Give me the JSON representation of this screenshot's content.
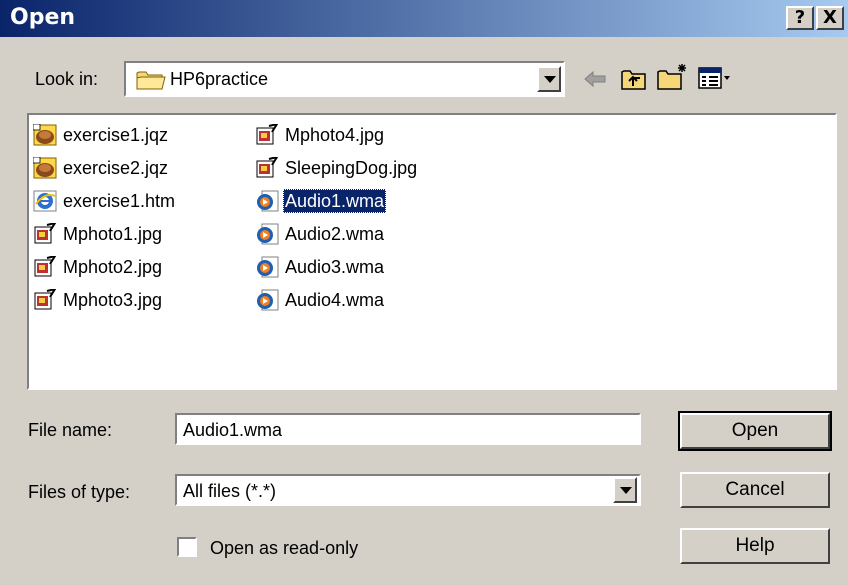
{
  "titlebar": {
    "title": "Open",
    "help_label": "?",
    "close_label": "X"
  },
  "lookin": {
    "label": "Look in:",
    "value": "HP6practice",
    "folder_icon": "folder-icon"
  },
  "toolbar": {
    "icons": [
      "back-arrow-icon",
      "up-folder-icon",
      "new-folder-icon",
      "view-menu-icon"
    ]
  },
  "files": [
    {
      "name": "exercise1.jqz",
      "icon": "jqz-icon"
    },
    {
      "name": "exercise2.jqz",
      "icon": "jqz-icon"
    },
    {
      "name": "exercise1.htm",
      "icon": "ie-icon"
    },
    {
      "name": "Mphoto1.jpg",
      "icon": "jpg-icon"
    },
    {
      "name": "Mphoto2.jpg",
      "icon": "jpg-icon"
    },
    {
      "name": "Mphoto3.jpg",
      "icon": "jpg-icon"
    },
    {
      "name": "Mphoto4.jpg",
      "icon": "jpg-icon"
    },
    {
      "name": "SleepingDog.jpg",
      "icon": "jpg-icon"
    },
    {
      "name": "Audio1.wma",
      "icon": "wma-icon",
      "selected": true
    },
    {
      "name": "Audio2.wma",
      "icon": "wma-icon"
    },
    {
      "name": "Audio3.wma",
      "icon": "wma-icon"
    },
    {
      "name": "Audio4.wma",
      "icon": "wma-icon"
    }
  ],
  "filename": {
    "label": "File name:",
    "value": "Audio1.wma"
  },
  "filetype": {
    "label": "Files of type:",
    "value": "All files (*.*)"
  },
  "readonly": {
    "label": "Open as read-only",
    "checked": false
  },
  "buttons": {
    "open": "Open",
    "cancel": "Cancel",
    "help": "Help"
  },
  "colors": {
    "title_start": "#0a246a",
    "title_end": "#a6caf0",
    "selection": "#0a246a",
    "face": "#d4d0c8"
  }
}
